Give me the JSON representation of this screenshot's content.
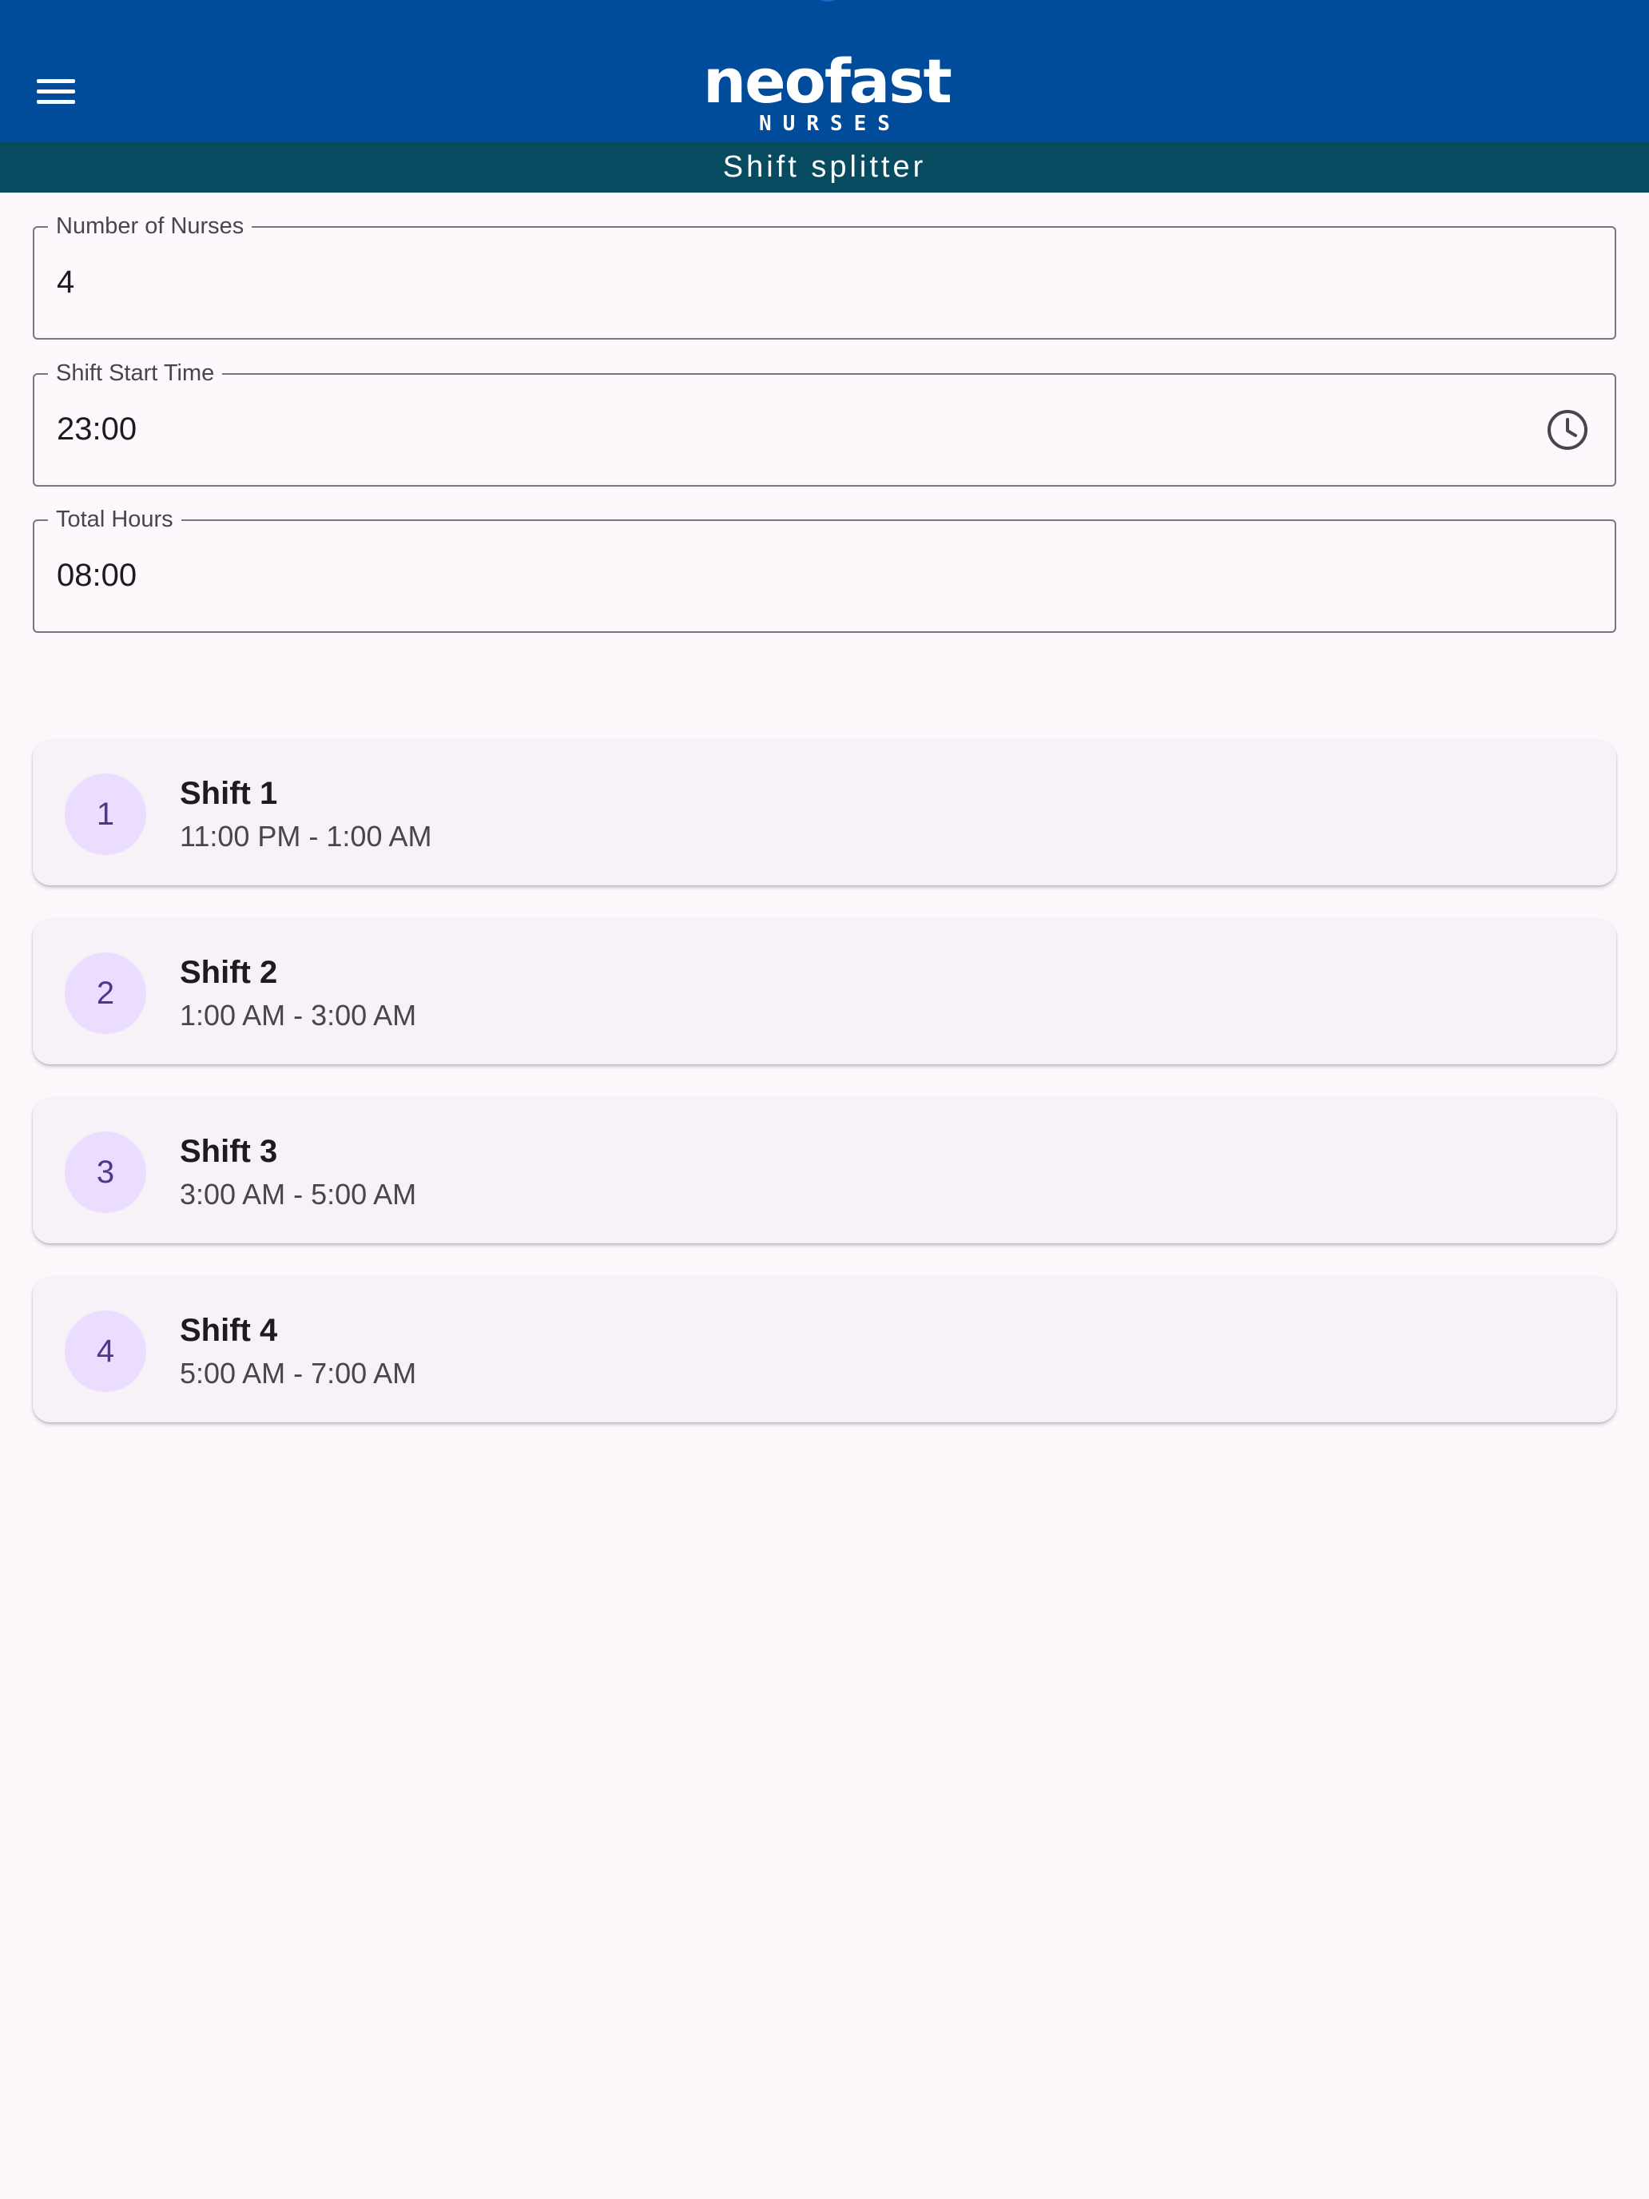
{
  "app_bar": {
    "logo_word": "neofast",
    "logo_sub": "NURSES",
    "menu_icon": "hamburger-menu-icon",
    "color": "#004b9a"
  },
  "sub_bar": {
    "title": "Shift splitter",
    "color": "#074b61"
  },
  "form": {
    "nurses": {
      "label": "Number of Nurses",
      "value": "4"
    },
    "start_time": {
      "label": "Shift Start Time",
      "value": "23:00",
      "icon": "clock-icon"
    },
    "total_hours": {
      "label": "Total Hours",
      "value": "08:00"
    }
  },
  "shifts": [
    {
      "number": "1",
      "title": "Shift 1",
      "time": "11:00 PM - 1:00 AM"
    },
    {
      "number": "2",
      "title": "Shift 2",
      "time": "1:00 AM - 3:00 AM"
    },
    {
      "number": "3",
      "title": "Shift 3",
      "time": "3:00 AM - 5:00 AM"
    },
    {
      "number": "4",
      "title": "Shift 4",
      "time": "5:00 AM - 7:00 AM"
    }
  ],
  "colors": {
    "background": "#fef7fc",
    "card": "#f6f2f7",
    "avatar": "#eaddff",
    "avatar_text": "#4f378a"
  }
}
